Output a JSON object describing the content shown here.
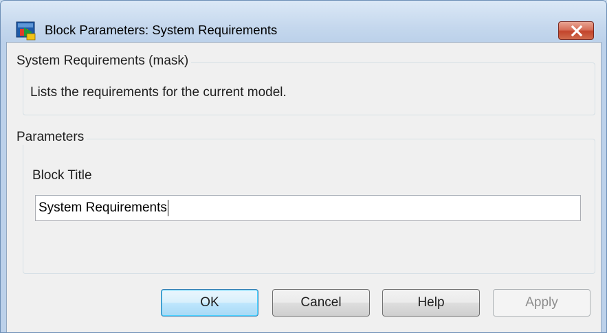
{
  "window": {
    "title": "Block Parameters: System Requirements",
    "icon": "simulink-block-icon",
    "close_icon": "close-icon"
  },
  "mask_group": {
    "legend": "System Requirements (mask)",
    "description": "Lists the requirements for the current model."
  },
  "parameters_group": {
    "legend": "Parameters",
    "block_title_label": "Block Title",
    "block_title_value": "System Requirements"
  },
  "buttons": {
    "ok": "OK",
    "cancel": "Cancel",
    "help": "Help",
    "apply": "Apply"
  }
}
